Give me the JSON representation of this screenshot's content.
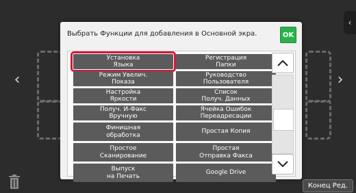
{
  "dialog": {
    "title": "Выбрать Функции для добавления в Основной экра.",
    "ok_label": "OK"
  },
  "functions": [
    {
      "label": "Установка\nЯзыка",
      "selected": true
    },
    {
      "label": "Регистрация\nПапки",
      "selected": false
    },
    {
      "label": "Режим Увелич.\nПоказа",
      "selected": false
    },
    {
      "label": "Руководство\nПользователя",
      "selected": false
    },
    {
      "label": "Настройка\nЯркости",
      "selected": false
    },
    {
      "label": "Список\nПолуч. Данных",
      "selected": false
    },
    {
      "label": "Получ. И-Факс\nВручную",
      "selected": false
    },
    {
      "label": "Ячейка Ошибок\nПереадресации",
      "selected": false
    },
    {
      "label": "Финишная\nобработка",
      "selected": false
    },
    {
      "label": "Простая Копия",
      "selected": false
    },
    {
      "label": "Простое\nСканирование",
      "selected": false
    },
    {
      "label": "Простая\nОтправка Факса",
      "selected": false
    },
    {
      "label": "Выпуск\nна Печать",
      "selected": false
    },
    {
      "label": "Google Drive",
      "selected": false
    }
  ],
  "scroll": {
    "position": 0.6
  },
  "footer": {
    "end_edit_label": "Конец Ред."
  },
  "colors": {
    "background": "#2c2c2c",
    "item": "#5b5b5b",
    "selection_outline": "#d6173c",
    "ok_button": "#2bb24c"
  },
  "icons": {
    "prev": "chevron-left-icon",
    "next": "chevron-right-icon",
    "side_tab": "chevron-left-icon",
    "trash": "trash-icon",
    "scroll_up": "chevron-up-icon",
    "scroll_down": "chevron-down-icon"
  }
}
